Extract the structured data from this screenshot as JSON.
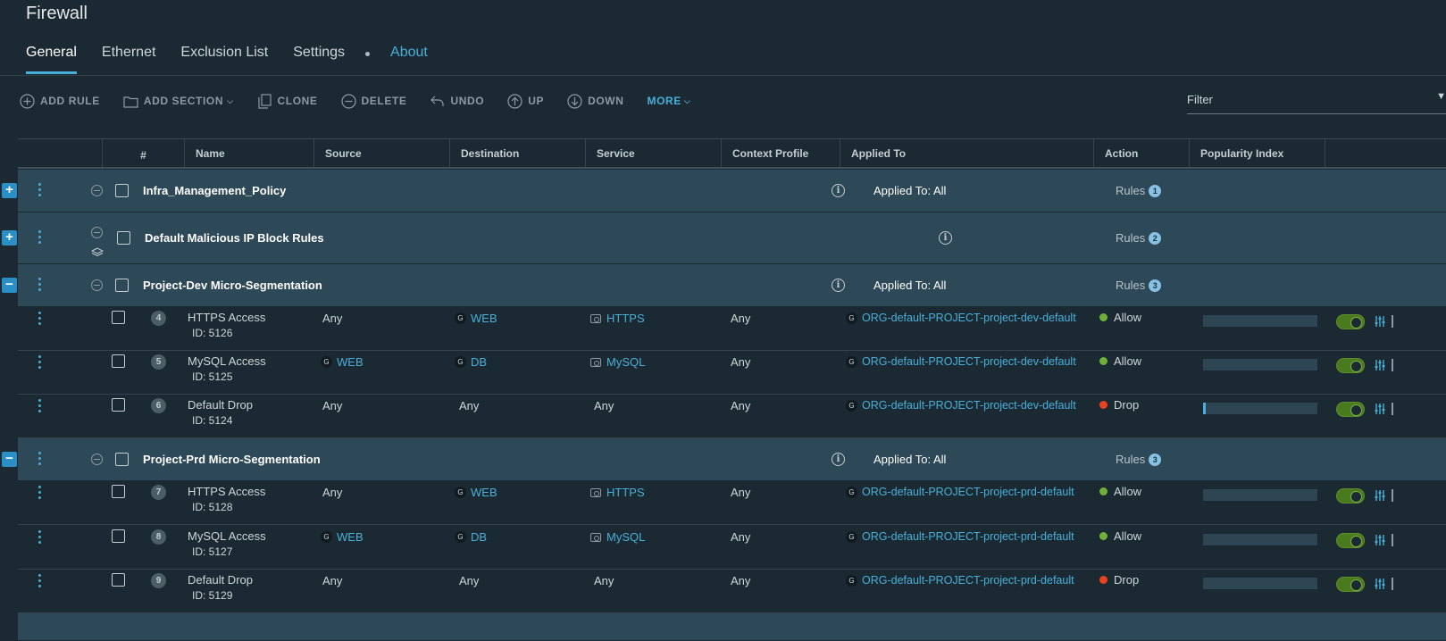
{
  "page": {
    "title": "Firewall"
  },
  "tabs": [
    {
      "label": "General"
    },
    {
      "label": "Ethernet"
    },
    {
      "label": "Exclusion List"
    },
    {
      "label": "Settings"
    },
    {
      "label": "About"
    }
  ],
  "toolbar": {
    "add_rule": "ADD RULE",
    "add_section": "ADD SECTION",
    "clone": "CLONE",
    "delete": "DELETE",
    "undo": "UNDO",
    "up": "UP",
    "down": "DOWN",
    "more": "MORE"
  },
  "filter": {
    "placeholder": "Filter"
  },
  "columns": {
    "num": "#",
    "name": "Name",
    "source": "Source",
    "destination": "Destination",
    "service": "Service",
    "context_profile": "Context Profile",
    "applied_to": "Applied To",
    "action": "Action",
    "popularity": "Popularity Index"
  },
  "sections": [
    {
      "name": "Infra_Management_Policy",
      "applied_to": "Applied To: All",
      "rules_label": "Rules",
      "rules_count": "1",
      "expand": "+"
    },
    {
      "name": "Default Malicious IP Block Rules",
      "applied_to": "",
      "rules_label": "Rules",
      "rules_count": "2",
      "expand": "+"
    },
    {
      "name": "Project-Dev Micro-Segmentation",
      "applied_to": "Applied To: All",
      "rules_label": "Rules",
      "rules_count": "3",
      "expand": "−"
    },
    {
      "name": "Project-Prd Micro-Segmentation",
      "applied_to": "Applied To: All",
      "rules_label": "Rules",
      "rules_count": "3",
      "expand": "−"
    }
  ],
  "rules": [
    {
      "num": "4",
      "name": "HTTPS Access",
      "id": "ID: 5126",
      "source": "Any",
      "destination": "WEB",
      "service": "HTTPS",
      "context": "Any",
      "applied_to": "ORG-default-PROJECT-project-dev-default",
      "action": "Allow",
      "popularity": 0
    },
    {
      "num": "5",
      "name": "MySQL Access",
      "id": "ID: 5125",
      "source": "WEB",
      "destination": "DB",
      "service": "MySQL",
      "context": "Any",
      "applied_to": "ORG-default-PROJECT-project-dev-default",
      "action": "Allow",
      "popularity": 0
    },
    {
      "num": "6",
      "name": "Default Drop",
      "id": "ID: 5124",
      "source": "Any",
      "destination": "Any",
      "service": "Any",
      "context": "Any",
      "applied_to": "ORG-default-PROJECT-project-dev-default",
      "action": "Drop",
      "popularity": 0.02
    },
    {
      "num": "7",
      "name": "HTTPS Access",
      "id": "ID: 5128",
      "source": "Any",
      "destination": "WEB",
      "service": "HTTPS",
      "context": "Any",
      "applied_to": "ORG-default-PROJECT-project-prd-default",
      "action": "Allow",
      "popularity": 0
    },
    {
      "num": "8",
      "name": "MySQL Access",
      "id": "ID: 5127",
      "source": "WEB",
      "destination": "DB",
      "service": "MySQL",
      "context": "Any",
      "applied_to": "ORG-default-PROJECT-project-prd-default",
      "action": "Allow",
      "popularity": 0
    },
    {
      "num": "9",
      "name": "Default Drop",
      "id": "ID: 5129",
      "source": "Any",
      "destination": "Any",
      "service": "Any",
      "context": "Any",
      "applied_to": "ORG-default-PROJECT-project-prd-default",
      "action": "Drop",
      "popularity": 0
    }
  ],
  "colors": {
    "accent": "#49afd9",
    "allow": "#6fb13a",
    "drop": "#e8431e",
    "section_bg": "#2d4857"
  },
  "icons": {
    "group_badge": "G",
    "info": "i"
  }
}
